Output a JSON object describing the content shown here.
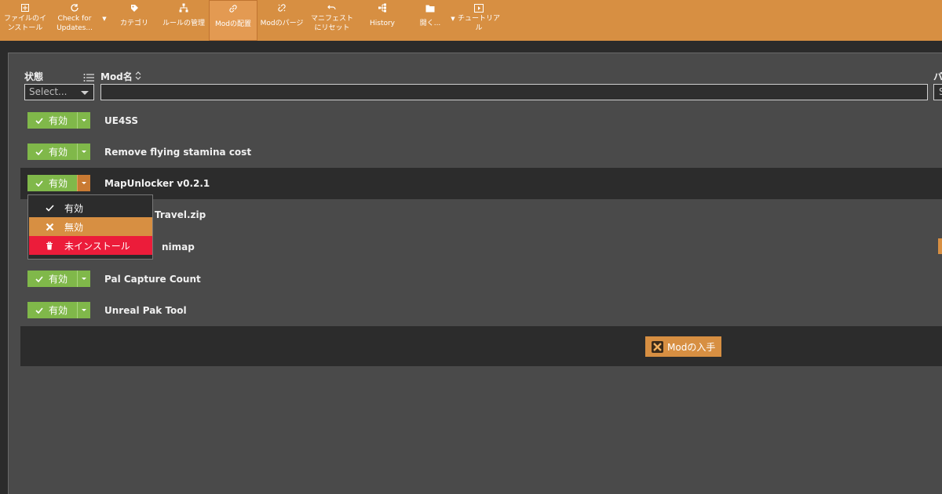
{
  "toolbar": {
    "items": [
      {
        "name": "install-from-file",
        "lines": [
          "ファイルのイ",
          "ンストール"
        ]
      },
      {
        "name": "check-updates",
        "lines": [
          "Check for",
          "Updates..."
        ]
      },
      {
        "name": "categories",
        "lines": [
          "カテゴリ"
        ]
      },
      {
        "name": "manage-rules",
        "lines": [
          "ルールの管理"
        ]
      },
      {
        "name": "deploy-mods",
        "lines": [
          "Modの配置"
        ]
      },
      {
        "name": "purge-mods",
        "lines": [
          "Modのパージ"
        ]
      },
      {
        "name": "reset-manifest",
        "lines": [
          "マニフェスト",
          "にリセット"
        ]
      },
      {
        "name": "history",
        "lines": [
          "History"
        ]
      },
      {
        "name": "open",
        "lines": [
          "開く..."
        ]
      },
      {
        "name": "tutorial",
        "lines": [
          "チュートリア",
          "ル"
        ]
      }
    ]
  },
  "table": {
    "col_status": "状態",
    "col_name": "Mod名",
    "col_version_partial": "バ",
    "status_placeholder": "Select...",
    "version_placeholder": "S"
  },
  "rows": [
    {
      "state": "有効",
      "name": "UE4SS"
    },
    {
      "state": "有効",
      "name": "Remove flying stamina cost"
    },
    {
      "state": "有効",
      "name": "MapUnlocker v0.2.1"
    },
    {
      "state": "",
      "name": "Travel.zip"
    },
    {
      "state": "",
      "name": "nimap"
    },
    {
      "state": "有効",
      "name": "Pal Capture Count"
    },
    {
      "state": "有効",
      "name": "Unreal Pak Tool"
    }
  ],
  "menu": {
    "enabled": "有効",
    "disabled": "無効",
    "uninstalled": "未インストール"
  },
  "footer": {
    "get_mods": "Modの入手"
  },
  "colors": {
    "toolbar": "#d78f42",
    "enabled": "#80b84a",
    "danger": "#ec1c3a"
  }
}
